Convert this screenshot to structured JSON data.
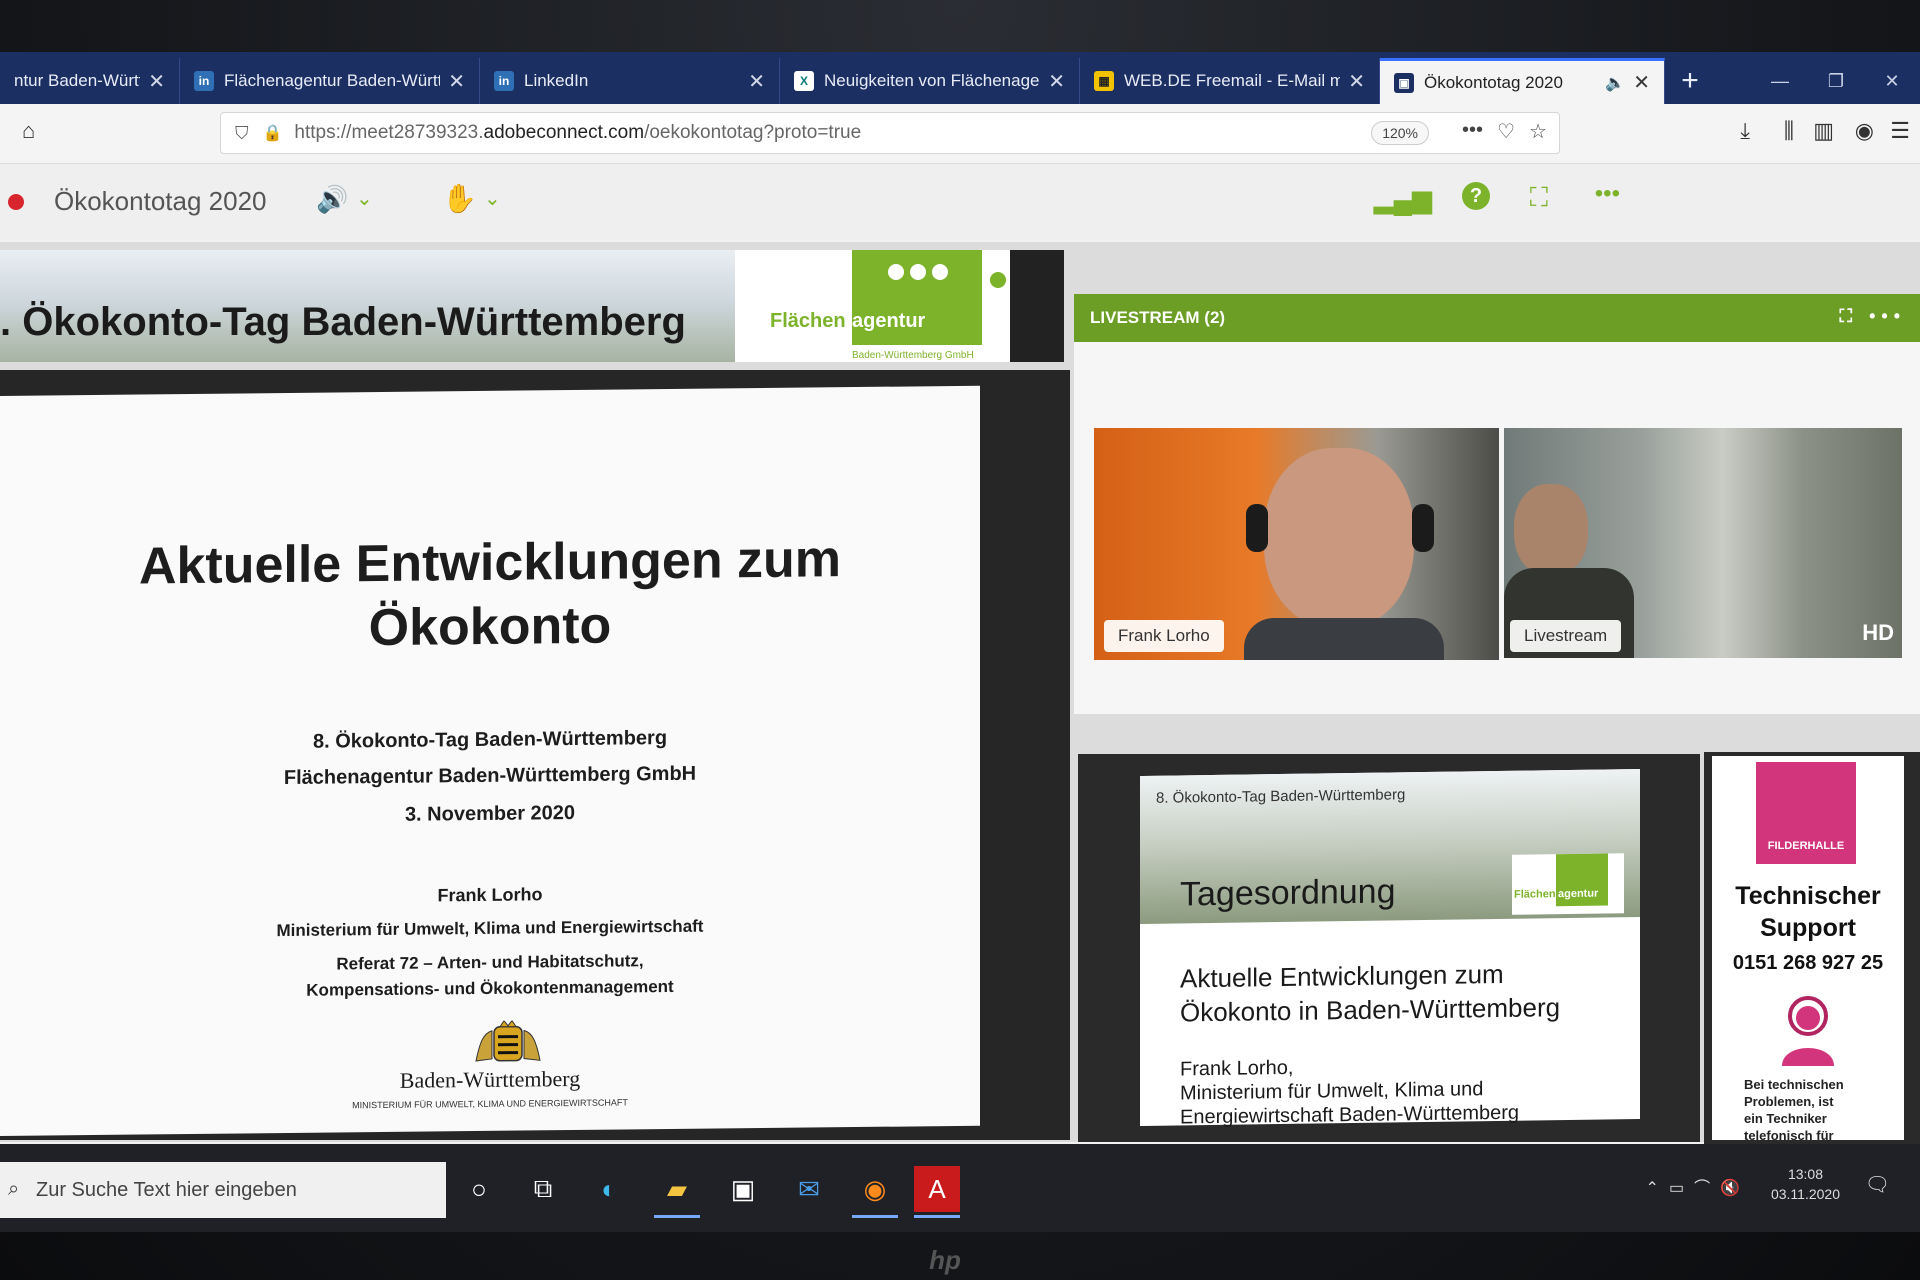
{
  "tabs": [
    {
      "title": "ntur Baden-Württe",
      "icon": "page-icon"
    },
    {
      "title": "Flächenagentur Baden-Württe",
      "icon": "linkedin-icon"
    },
    {
      "title": "LinkedIn",
      "icon": "linkedin-icon"
    },
    {
      "title": "Neuigkeiten von Flächenagent",
      "icon": "xing-icon"
    },
    {
      "title": "WEB.DE Freemail - E-Mail ma",
      "icon": "webde-icon"
    },
    {
      "title": "Ökokontotag 2020",
      "icon": "adobe-connect-icon",
      "active": true
    }
  ],
  "address": {
    "prefix": "https://meet28739323.",
    "host": "adobeconnect.com",
    "path": "/oekokontotag?proto=true",
    "zoom": "120%"
  },
  "meeting": {
    "title": "Ökokontotag 2020"
  },
  "presentation": {
    "header_title": ". Ökokonto-Tag Baden-Württemberg",
    "logo_text_left": "Flächen",
    "logo_text_right": "agentur",
    "logo_sub": "Baden-Württemberg GmbH",
    "slide_title": "Aktuelle Entwicklungen zum Ökokonto",
    "lines": [
      "8. Ökokonto-Tag Baden-Württemberg",
      "Flächenagentur Baden-Württemberg GmbH",
      "3. November 2020",
      "Frank Lorho",
      "Ministerium für Umwelt, Klima und Energiewirtschaft",
      "Referat 72 – Arten- und Habitatschutz,",
      "Kompensations- und Ökokontenmanagement"
    ],
    "state_name": "Baden-Württemberg",
    "ministry_caption": "MINISTERIUM FÜR UMWELT, KLIMA UND ENERGIEWIRTSCHAFT"
  },
  "livestream": {
    "title": "LIVESTREAM (2)",
    "participants": [
      "Frank Lorho",
      "Livestream"
    ],
    "badge": "HD"
  },
  "agenda": {
    "small_title": "8. Ökokonto-Tag Baden-Württemberg",
    "title": "Tagesordnung",
    "logo_left": "Flächen",
    "logo_right": "agentur",
    "item": "Aktuelle Entwicklungen zum\nÖkokonto in Baden-Württemberg",
    "speaker": "Frank Lorho,\nMinisterium für Umwelt, Klima und\nEnergiewirtschaft Baden-Württemberg"
  },
  "support": {
    "logo_text": "FILDERHALLE",
    "title": "Technischer\nSupport",
    "phone": "0151 268 927 25",
    "note": "Bei technischen\nProblemen, ist\nein Techniker\ntelefonisch für\nSie erreichbar"
  },
  "taskbar": {
    "search_placeholder": "Zur Suche Text hier eingeben",
    "time": "13:08",
    "date": "03.11.2020"
  },
  "brand": "hp",
  "colors": {
    "tabstrip": "#1c2f63",
    "livestream_green": "#6c9d25",
    "agentur_green": "#7db32a",
    "filderhalle_pink": "#d2357b"
  }
}
